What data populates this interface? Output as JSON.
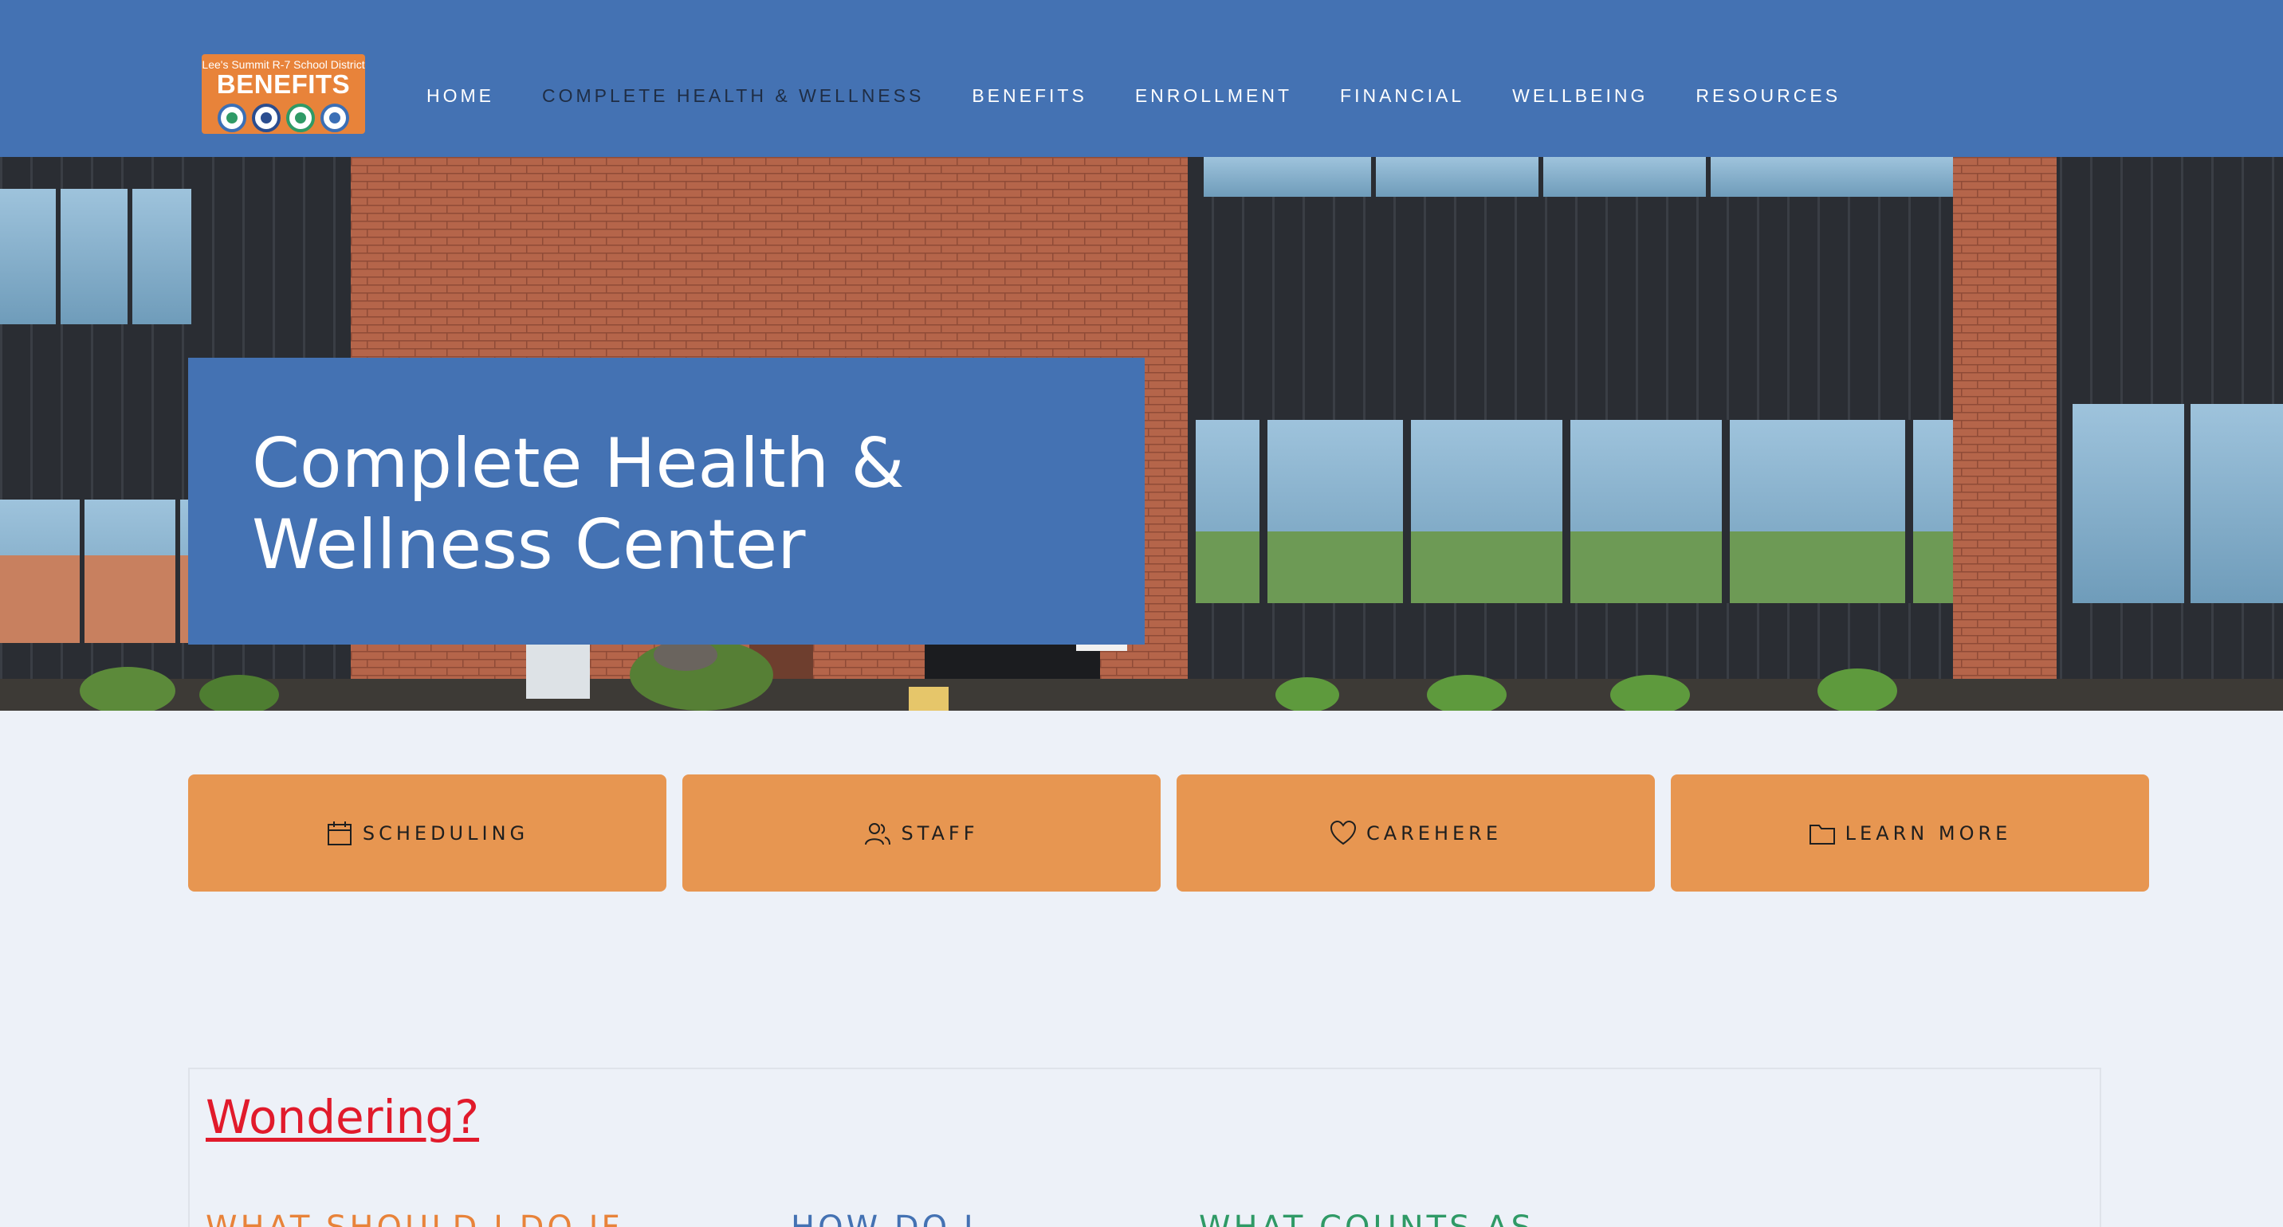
{
  "header": {
    "logo": {
      "district": "Lee's Summit R-7 School District",
      "brand": "BENEFITS"
    },
    "nav": [
      {
        "label": "HOME",
        "active": false
      },
      {
        "label": "COMPLETE HEALTH & WELLNESS",
        "active": true
      },
      {
        "label": "BENEFITS",
        "active": false
      },
      {
        "label": "ENROLLMENT",
        "active": false
      },
      {
        "label": "FINANCIAL",
        "active": false
      },
      {
        "label": "WELLBEING",
        "active": false
      },
      {
        "label": "RESOURCES",
        "active": false
      }
    ]
  },
  "hero": {
    "title": "Complete Health & Wellness Center"
  },
  "quick_links": [
    {
      "label": "SCHEDULING",
      "icon": "calendar-icon"
    },
    {
      "label": "STAFF",
      "icon": "people-icon"
    },
    {
      "label": "CAREHERE",
      "icon": "heart-icon"
    },
    {
      "label": "LEARN MORE",
      "icon": "folder-icon"
    }
  ],
  "wondering": {
    "title": "Wondering?",
    "items": [
      "WHAT SHOULD I DO IF",
      "HOW DO I",
      "WHAT COUNTS AS"
    ]
  },
  "colors": {
    "header_bg": "#4472b3",
    "accent_orange": "#e79651",
    "page_bg": "#edf1f8",
    "wondering_red": "#e11a2b",
    "faq_orange": "#e8833a",
    "faq_blue": "#4472b3",
    "faq_green": "#2f9a66"
  }
}
